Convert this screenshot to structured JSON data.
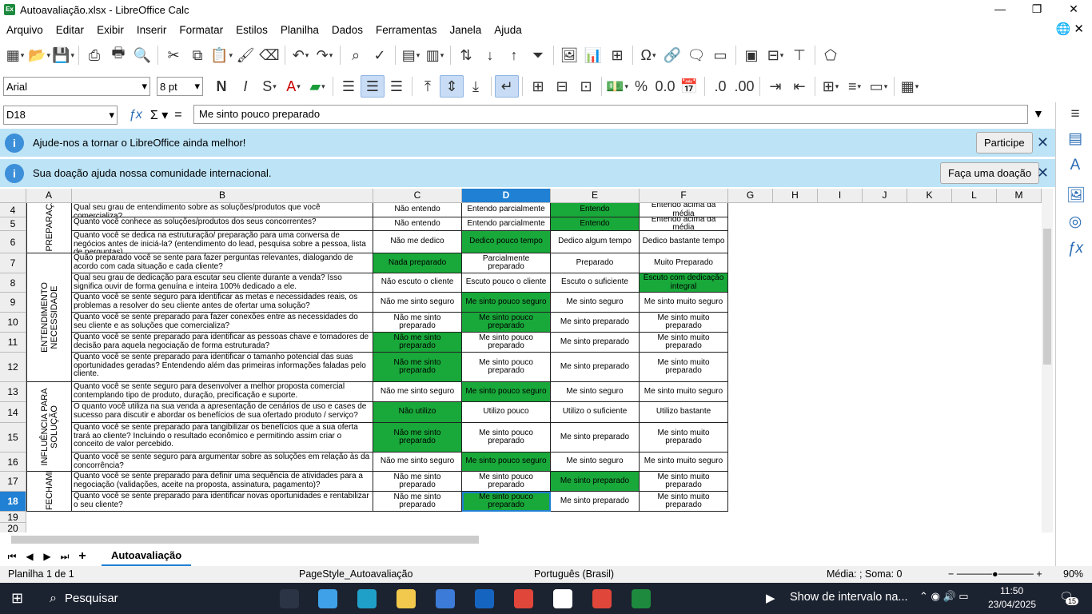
{
  "window": {
    "title": "Autoavaliação.xlsx - LibreOffice Calc",
    "app_badge": "Ex"
  },
  "menu": [
    "Arquivo",
    "Editar",
    "Exibir",
    "Inserir",
    "Formatar",
    "Estilos",
    "Planilha",
    "Dados",
    "Ferramentas",
    "Janela",
    "Ajuda"
  ],
  "format": {
    "font_name": "Arial",
    "font_size": "8 pt"
  },
  "formula_bar": {
    "name_box": "D18",
    "content": "Me sinto pouco preparado"
  },
  "infobars": [
    {
      "text": "Ajude-nos a tornar o LibreOffice ainda melhor!",
      "button": "Participe"
    },
    {
      "text": "Sua doação ajuda nossa comunidade internacional.",
      "button": "Faça uma doação"
    }
  ],
  "columns": [
    "A",
    "B",
    "C",
    "D",
    "E",
    "F",
    "G",
    "H",
    "I",
    "J",
    "K",
    "L",
    "M"
  ],
  "selected_col": "D",
  "rows": [
    {
      "n": "4",
      "q": "Qual seu grau de entendimento sobre as soluções/produtos que você comercializa?",
      "c": "Não entendo",
      "d": "Entendo parcialmente",
      "e": "Entendo",
      "f": "Entendo acima da média",
      "green": "e"
    },
    {
      "n": "5",
      "q": "Quanto você conhece as soluções/produtos dos seus concorrentes?",
      "c": "Não entendo",
      "d": "Entendo parcialmente",
      "e": "Entendo",
      "f": "Entendo acima da média",
      "green": "e"
    },
    {
      "n": "6",
      "q": "Quanto você se dedica na estruturação/ preparação para uma conversa de negócios antes de iniciá-la? (entendimento do lead, pesquisa sobre a pessoa, lista de perguntas)",
      "c": "Não me dedico",
      "d": "Dedico pouco tempo",
      "e": "Dedico algum tempo",
      "f": "Dedico bastante tempo",
      "green": "d"
    },
    {
      "n": "7",
      "q": "Quão preparado você se sente para fazer perguntas relevantes, dialogando de acordo com cada situação e cada cliente?",
      "c": "Nada preparado",
      "d": "Parcialmente preparado",
      "e": "Preparado",
      "f": "Muito Preparado",
      "green": "c"
    },
    {
      "n": "8",
      "q": "Qual seu grau de dedicação para escutar seu cliente durante a venda? Isso significa ouvir de forma genuína e inteira 100% dedicado a ele.",
      "c": "Não escuto o cliente",
      "d": "Escuto pouco o cliente",
      "e": "Escuto o suficiente",
      "f": "Escuto com dedicação integral",
      "green": "f"
    },
    {
      "n": "9",
      "q": "Quanto você se sente seguro para identificar as metas e necessidades reais, os problemas a resolver do seu cliente antes de ofertar uma solução?",
      "c": "Não me sinto seguro",
      "d": "Me sinto pouco seguro",
      "e": "Me sinto seguro",
      "f": "Me sinto muito seguro",
      "green": "d"
    },
    {
      "n": "10",
      "q": "Quanto você se sente preparado para fazer conexões entre as necessidades do seu cliente e as soluções que comercializa?",
      "c": "Não me sinto preparado",
      "d": "Me sinto pouco preparado",
      "e": "Me sinto preparado",
      "f": "Me sinto muito preparado",
      "green": "d"
    },
    {
      "n": "11",
      "q": "Quanto você se sente preparado para identificar as pessoas chave e tomadores de decisão para aquela negociação de forma estruturada?",
      "c": "Não me sinto preparado",
      "d": "Me sinto pouco preparado",
      "e": "Me sinto preparado",
      "f": "Me sinto muito preparado",
      "green": "c"
    },
    {
      "n": "12",
      "q": "Quanto você se sente preparado para identificar o tamanho potencial das suas oportunidades geradas? Entendendo além das primeiras informações faladas pelo cliente.",
      "c": "Não me sinto preparado",
      "d": "Me sinto pouco preparado",
      "e": "Me sinto preparado",
      "f": "Me sinto muito preparado",
      "green": "c"
    },
    {
      "n": "13",
      "q": "Quanto você se sente seguro para desenvolver a melhor proposta comercial contemplando tipo de produto, duração, precificação e suporte.",
      "c": "Não me sinto seguro",
      "d": "Me sinto pouco seguro",
      "e": "Me sinto seguro",
      "f": "Me sinto muito seguro",
      "green": "d"
    },
    {
      "n": "14",
      "q": "O quanto você utiliza na sua venda a apresentação de cenários de uso e cases de sucesso para discutir e abordar os benefícios de sua ofertado produto / serviço?",
      "c": "Não utilizo",
      "d": "Utilizo pouco",
      "e": "Utilizo o suficiente",
      "f": "Utilizo bastante",
      "green": "c"
    },
    {
      "n": "15",
      "q": "Quanto você se sente preparado para tangibilizar os benefícios que a sua oferta trará ao cliente? Incluindo o resultado econômico e permitindo assim criar o conceito de valor percebido.",
      "c": "Não me sinto preparado",
      "d": "Me sinto pouco preparado",
      "e": "Me sinto preparado",
      "f": "Me sinto muito preparado",
      "green": "c"
    },
    {
      "n": "16",
      "q": "Quanto você se sente seguro para argumentar sobre as soluções em relação às da concorrência?",
      "c": "Não me sinto seguro",
      "d": "Me sinto pouco seguro",
      "e": "Me sinto seguro",
      "f": "Me sinto muito seguro",
      "green": "d"
    },
    {
      "n": "17",
      "q": "Quanto você se sente preparado para definir uma sequência de atividades para a negociação (validações, aceite na proposta, assinatura, pagamento)?",
      "c": "Não me sinto preparado",
      "d": "Me sinto pouco preparado",
      "e": "Me sinto preparado",
      "f": "Me sinto muito preparado",
      "green": "e"
    },
    {
      "n": "18",
      "q": "Quanto você se sente preparado para identificar novas oportunidades e rentabilizar o seu cliente?",
      "c": "Não me sinto preparado",
      "d": "Me sinto pouco preparado",
      "e": "Me sinto preparado",
      "f": "Me sinto muito preparado",
      "green": "d"
    }
  ],
  "extra_rows": [
    "19",
    "20"
  ],
  "sections": [
    "PREPARAÇÃO",
    "ENTENDIMENTO NECESSIDADE",
    "INFLUÊNCIA PARA SOLUÇÃO",
    "FECHAMENTO"
  ],
  "sheet_tab": "Autoavaliação",
  "status": {
    "sheet": "Planilha 1 de 1",
    "page_style": "PageStyle_Autoavaliação",
    "language": "Português (Brasil)",
    "sum": "Média: ; Soma: 0",
    "zoom": "90%"
  },
  "taskbar": {
    "search": "Pesquisar",
    "media": "Show de intervalo na...",
    "time": "11:50",
    "date": "23/04/2025",
    "notifications": "15"
  },
  "colors": {
    "green": "#19a83a",
    "accent": "#1f80d4",
    "info_bg": "#bce3f6"
  }
}
